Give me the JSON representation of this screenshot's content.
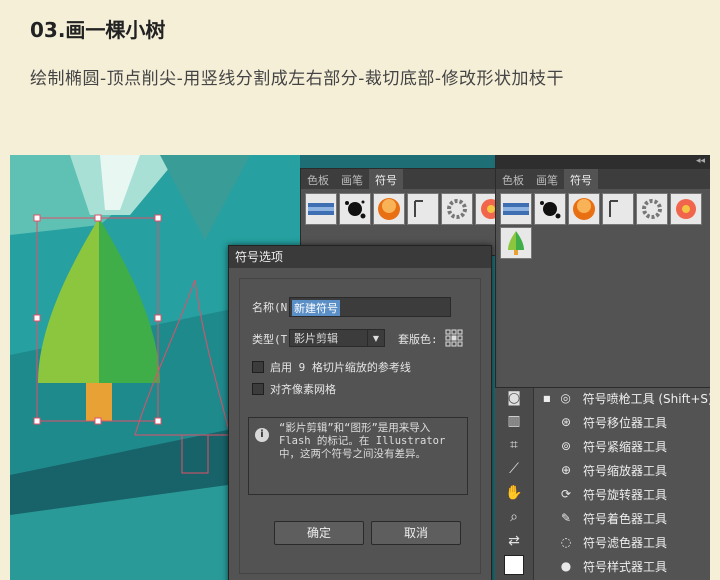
{
  "heading": "03.画一棵小树",
  "subtitle": "绘制椭圆-顶点削尖-用竖线分割成左右部分-裁切底部-修改形状加枝干",
  "colors": {
    "teal_dark": "#1c6e74",
    "teal": "#26a0a0",
    "teal_light": "#7fcfc4",
    "tree_left": "#8cc63f",
    "tree_right": "#3fae49",
    "trunk": "#e8a135",
    "selection": "#e0506a",
    "panel_bg": "#535353"
  },
  "panel_left": {
    "tabs": [
      "色板",
      "画笔",
      "符号"
    ],
    "active_tab": "符号"
  },
  "panel_right": {
    "tabs": [
      "色板",
      "画笔",
      "符号"
    ],
    "active_tab": "符号",
    "collapse_icon": "double-chevron-icon"
  },
  "dialog": {
    "title": "符号选项",
    "name_label": "名称(N):",
    "name_value": "新建符号",
    "type_label": "类型(T):",
    "type_value": "影片剪辑",
    "registration_label": "套版色:",
    "checkbox_9slice": "启用 9 格切片缩放的参考线",
    "checkbox_pixel": "对齐像素网格",
    "info_text": "“影片剪辑”和“图形”是用来导入 Flash 的标记。在 Illustrator 中，这两个符号之间没有差异。",
    "ok_label": "确定",
    "cancel_label": "取消"
  },
  "tool_menu": {
    "items": [
      {
        "icon": "symbol-sprayer-icon",
        "label": "符号喷枪工具 (Shift+S)",
        "selected": true
      },
      {
        "icon": "symbol-shifter-icon",
        "label": "符号移位器工具"
      },
      {
        "icon": "symbol-scruncher-icon",
        "label": "符号紧缩器工具"
      },
      {
        "icon": "symbol-sizer-icon",
        "label": "符号缩放器工具"
      },
      {
        "icon": "symbol-spinner-icon",
        "label": "符号旋转器工具"
      },
      {
        "icon": "symbol-stainer-icon",
        "label": "符号着色器工具"
      },
      {
        "icon": "symbol-screener-icon",
        "label": "符号滤色器工具"
      },
      {
        "icon": "symbol-styler-icon",
        "label": "符号样式器工具"
      }
    ]
  }
}
